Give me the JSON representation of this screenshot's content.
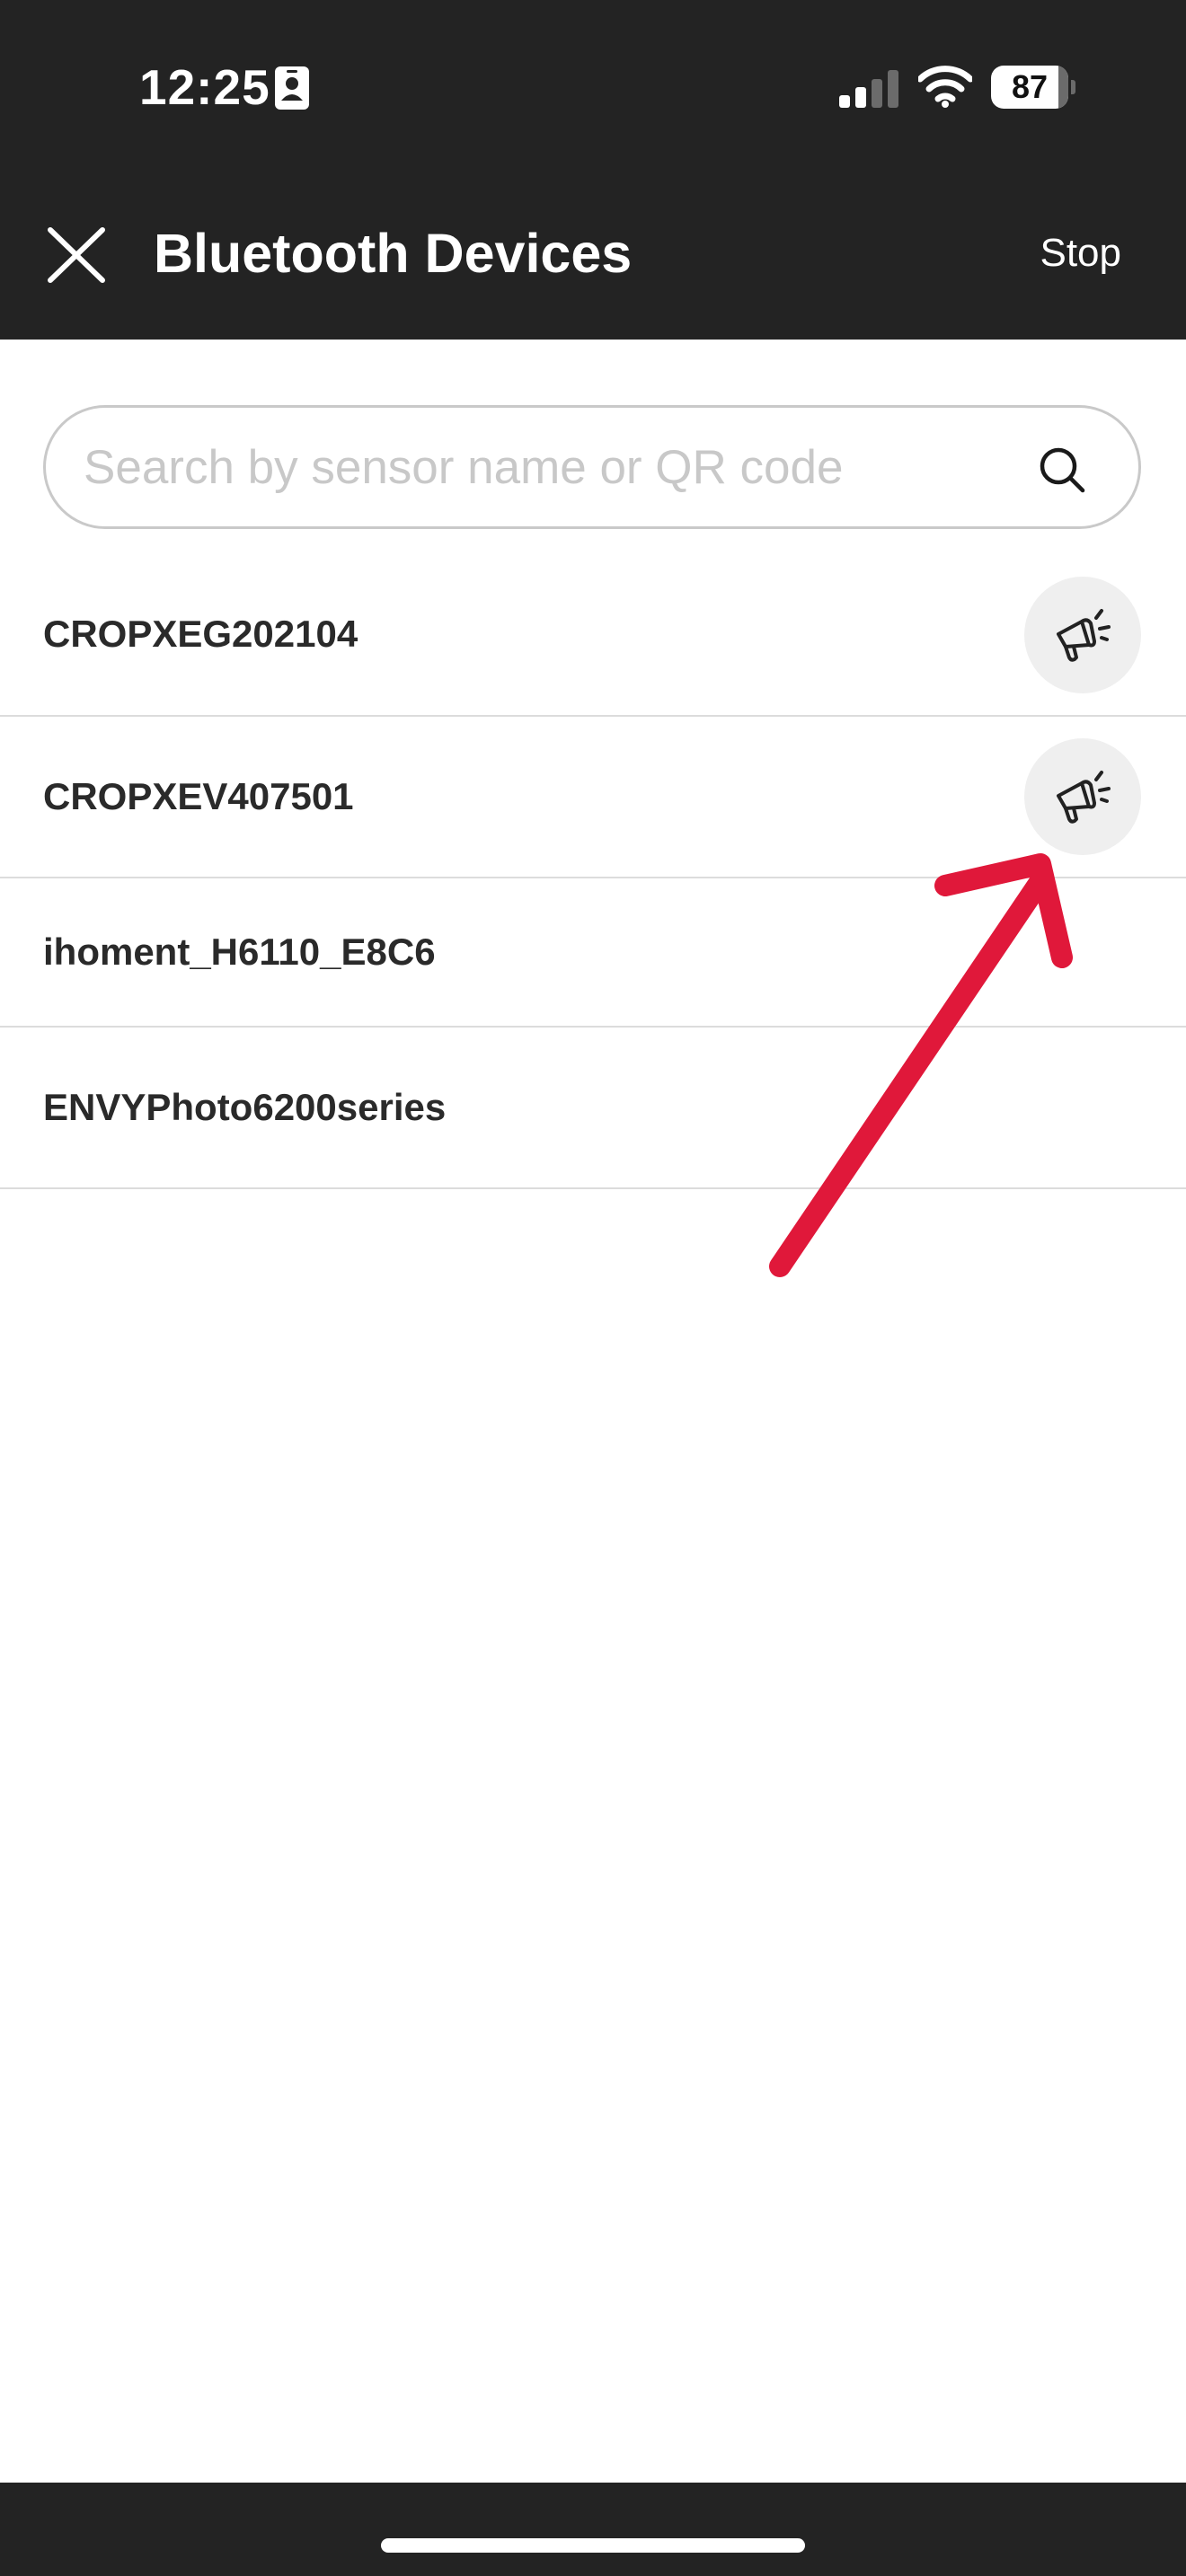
{
  "status_bar": {
    "time": "12:25",
    "battery_level": "87",
    "battery_fraction": 0.87,
    "icons": [
      "contact-card-icon",
      "cellular-signal-icon",
      "wifi-icon",
      "battery-icon"
    ]
  },
  "nav": {
    "close_icon": "close-icon",
    "title": "Bluetooth Devices",
    "stop_label": "Stop"
  },
  "search": {
    "placeholder": "Search by sensor name or QR code",
    "value": "",
    "icon": "search-icon"
  },
  "devices": [
    {
      "name": "CROPXEG202104",
      "has_identify_button": true,
      "identify_icon": "megaphone-icon"
    },
    {
      "name": "CROPXEV407501",
      "has_identify_button": true,
      "identify_icon": "megaphone-icon"
    },
    {
      "name": "ihoment_H6110_E8C6",
      "has_identify_button": false
    },
    {
      "name": "ENVYPhoto6200series",
      "has_identify_button": false
    }
  ],
  "colors": {
    "header_background": "#232323",
    "header_text": "#ffffff",
    "list_text": "#2a2a2a",
    "divider": "#dcdcdc",
    "identify_button_background": "#efefef",
    "annotation_arrow": "#e0183a"
  }
}
